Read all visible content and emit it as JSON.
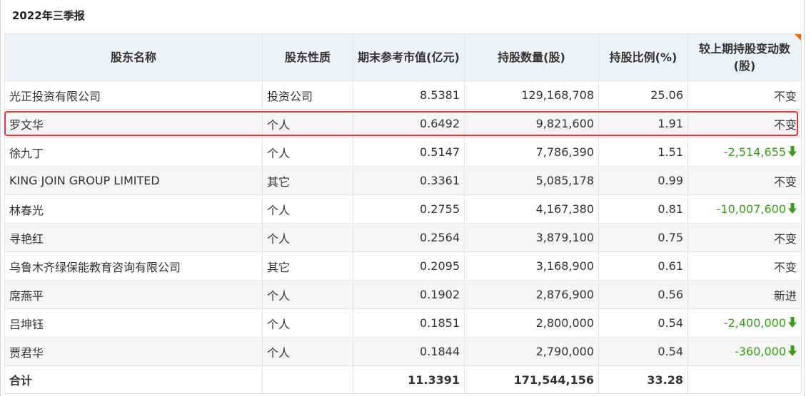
{
  "section_title": "2022年三季报",
  "headers": [
    "股东名称",
    "股东性质",
    "期末参考市值(亿元)",
    "持股数量(股)",
    "持股比例(%)",
    "较上期持股变动数(股)"
  ],
  "rows": [
    {
      "name": "光正投资有限公司",
      "type": "投资公司",
      "market_value": "8.5381",
      "shares": "129,168,708",
      "ratio": "25.06",
      "change": "不变",
      "direction": "none"
    },
    {
      "name": "罗文华",
      "type": "个人",
      "market_value": "0.6492",
      "shares": "9,821,600",
      "ratio": "1.91",
      "change": "不变",
      "direction": "none"
    },
    {
      "name": "徐九丁",
      "type": "个人",
      "market_value": "0.5147",
      "shares": "7,786,390",
      "ratio": "1.51",
      "change": "-2,514,655",
      "direction": "down"
    },
    {
      "name": "KING JOIN GROUP LIMITED",
      "type": "其它",
      "market_value": "0.3361",
      "shares": "5,085,178",
      "ratio": "0.99",
      "change": "不变",
      "direction": "none"
    },
    {
      "name": "林春光",
      "type": "个人",
      "market_value": "0.2755",
      "shares": "4,167,380",
      "ratio": "0.81",
      "change": "-10,007,600",
      "direction": "down"
    },
    {
      "name": "寻艳红",
      "type": "个人",
      "market_value": "0.2564",
      "shares": "3,879,100",
      "ratio": "0.75",
      "change": "不变",
      "direction": "none"
    },
    {
      "name": "乌鲁木齐绿保能教育咨询有限公司",
      "type": "其它",
      "market_value": "0.2095",
      "shares": "3,168,900",
      "ratio": "0.61",
      "change": "不变",
      "direction": "none"
    },
    {
      "name": "席燕平",
      "type": "个人",
      "market_value": "0.1902",
      "shares": "2,876,900",
      "ratio": "0.56",
      "change": "新进",
      "direction": "none"
    },
    {
      "name": "吕坤钰",
      "type": "个人",
      "market_value": "0.1851",
      "shares": "2,800,000",
      "ratio": "0.54",
      "change": "-2,400,000",
      "direction": "down"
    },
    {
      "name": "贾君华",
      "type": "个人",
      "market_value": "0.1844",
      "shares": "2,790,000",
      "ratio": "0.54",
      "change": "-360,000",
      "direction": "down"
    }
  ],
  "total": {
    "label": "合计",
    "market_value": "11.3391",
    "shares": "171,544,156",
    "ratio": "33.28"
  },
  "highlighted_row": 1,
  "colors": {
    "header_bg": "#eef1f5",
    "alt_row_bg": "#f5f5f5",
    "down": "#3b9c1c",
    "highlight": "#e53935",
    "corner": "#ff6a00"
  },
  "icons": {
    "down": "down-arrow-icon"
  }
}
